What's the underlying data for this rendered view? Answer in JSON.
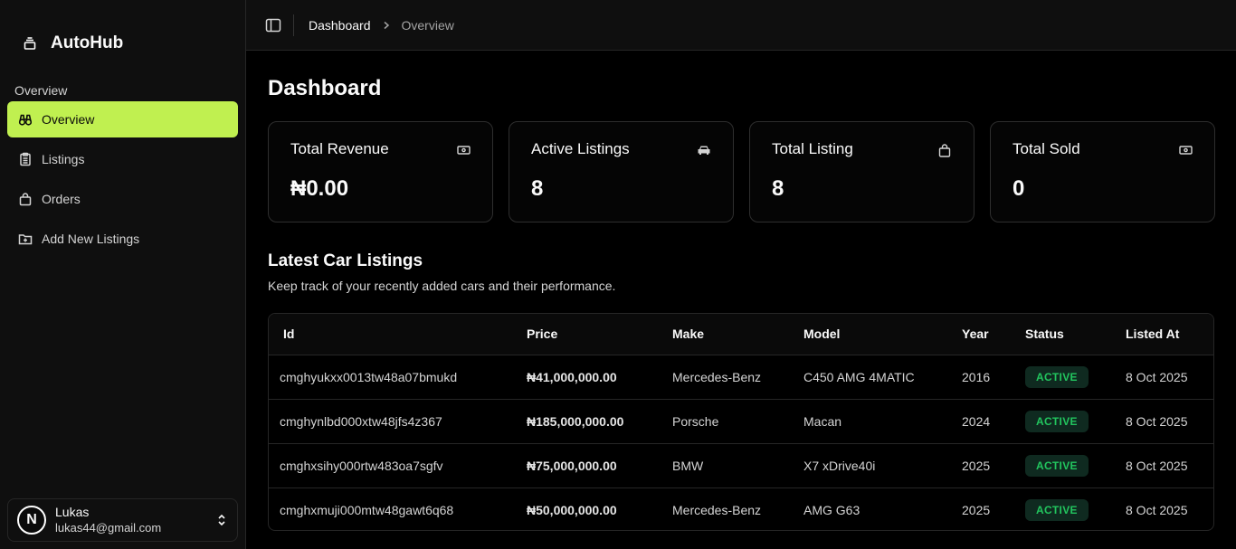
{
  "app": {
    "name": "AutoHub"
  },
  "sidebar": {
    "group_label": "Overview",
    "items": [
      {
        "label": "Overview",
        "icon": "binoculars-icon",
        "active": true
      },
      {
        "label": "Listings",
        "icon": "clipboard-list-icon",
        "active": false
      },
      {
        "label": "Orders",
        "icon": "shopping-bag-icon",
        "active": false
      },
      {
        "label": "Add New Listings",
        "icon": "folder-plus-icon",
        "active": false
      }
    ],
    "user": {
      "initial": "N",
      "name": "Lukas",
      "email": "lukas44@gmail.com"
    }
  },
  "header": {
    "breadcrumb": {
      "parent": "Dashboard",
      "current": "Overview"
    }
  },
  "main": {
    "title": "Dashboard",
    "stats": [
      {
        "label": "Total Revenue",
        "value": "₦0.00",
        "icon": "banknote-icon"
      },
      {
        "label": "Active Listings",
        "value": "8",
        "icon": "car-icon"
      },
      {
        "label": "Total Listing",
        "value": "8",
        "icon": "shopping-bag-icon"
      },
      {
        "label": "Total Sold",
        "value": "0",
        "icon": "banknote-icon"
      }
    ],
    "listings": {
      "title": "Latest Car Listings",
      "subtitle": "Keep track of your recently added cars and their performance.",
      "columns": [
        "Id",
        "Price",
        "Make",
        "Model",
        "Year",
        "Status",
        "Listed At"
      ],
      "rows": [
        {
          "id": "cmghyukxx0013tw48a07bmukd",
          "price": "₦41,000,000.00",
          "make": "Mercedes-Benz",
          "model": "C450 AMG 4MATIC",
          "year": "2016",
          "status": "ACTIVE",
          "listed_at": "8 Oct 2025"
        },
        {
          "id": "cmghynlbd000xtw48jfs4z367",
          "price": "₦185,000,000.00",
          "make": "Porsche",
          "model": "Macan",
          "year": "2024",
          "status": "ACTIVE",
          "listed_at": "8 Oct 2025"
        },
        {
          "id": "cmghxsihy000rtw483oa7sgfv",
          "price": "₦75,000,000.00",
          "make": "BMW",
          "model": "X7 xDrive40i",
          "year": "2025",
          "status": "ACTIVE",
          "listed_at": "8 Oct 2025"
        },
        {
          "id": "cmghxmuji000mtw48gawt6q68",
          "price": "₦50,000,000.00",
          "make": "Mercedes-Benz",
          "model": "AMG G63",
          "year": "2025",
          "status": "ACTIVE",
          "listed_at": "8 Oct 2025"
        }
      ]
    }
  },
  "colors": {
    "accent": "#c0f050",
    "status_active_text": "#22c55e",
    "status_active_bg": "#0f2a20",
    "background": "#000000",
    "sidebar_bg": "#0f0f0f"
  }
}
